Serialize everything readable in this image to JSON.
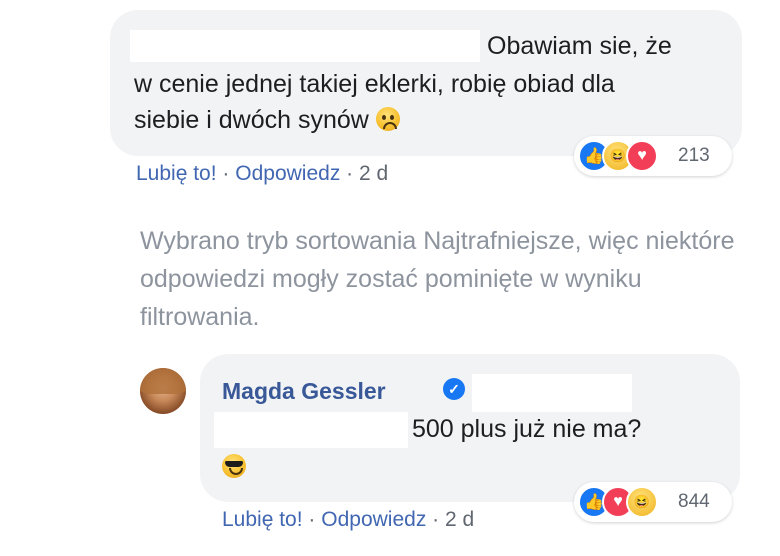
{
  "comment1": {
    "text_line1": "Obawiam sie, że",
    "text_line2": "w cenie jednej takiej eklerki, robię obiad dla",
    "text_line3": "siebie i dwóch synów",
    "emoji": "frowning-face-icon",
    "reactions": {
      "icons": [
        "like-icon",
        "haha-icon",
        "love-icon"
      ],
      "count": "213"
    },
    "actions": {
      "like": "Lubię to!",
      "sep": "·",
      "reply": "Odpowiedz",
      "time": "2 d"
    }
  },
  "filter_note": "Wybrano tryb sortowania Najtrafniejsze, więc niektóre odpowiedzi mogły zostać pominięte w wyniku filtrowania.",
  "comment2": {
    "author": "Magda Gessler",
    "text": "500 plus już nie ma?",
    "emoji": "sunglasses-face-icon",
    "reactions": {
      "icons": [
        "like-icon",
        "love-icon",
        "haha-icon"
      ],
      "count": "844"
    },
    "actions": {
      "like": "Lubię to!",
      "sep": "·",
      "reply": "Odpowiedz",
      "time": "2 d"
    }
  },
  "colors": {
    "bubble": "#f2f3f5",
    "link": "#4267b2",
    "author": "#385898",
    "muted": "#606770",
    "note": "#8d949e",
    "like": "#1877f2",
    "love": "#f33e58"
  }
}
